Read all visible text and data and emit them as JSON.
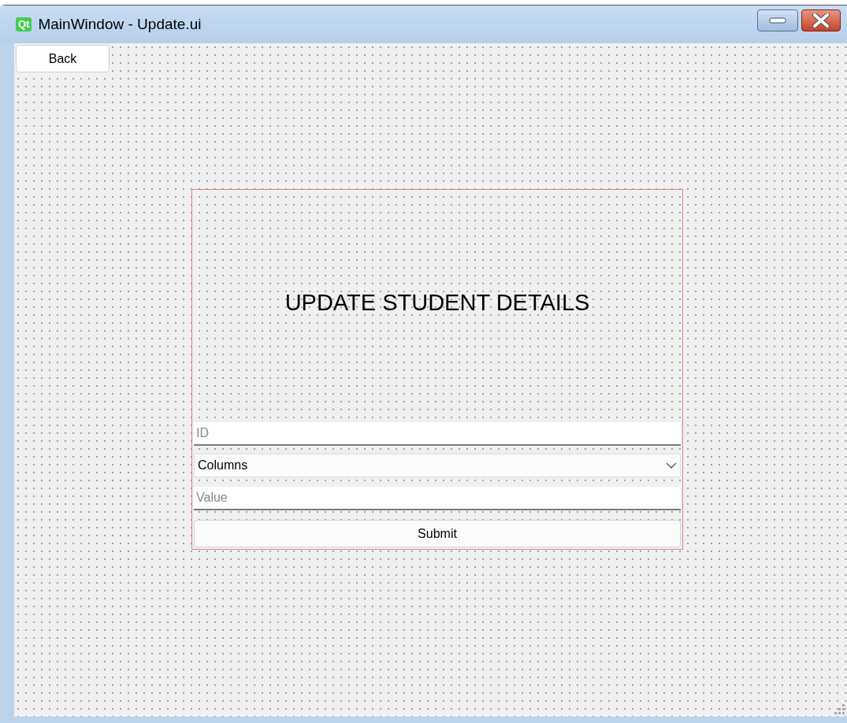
{
  "window": {
    "logo_text": "Qt",
    "title": "MainWindow - Update.ui"
  },
  "back_button": {
    "label": "Back"
  },
  "form": {
    "heading": "UPDATE STUDENT DETAILS",
    "id_field": {
      "placeholder": "ID"
    },
    "columns_dropdown": {
      "value": "Columns"
    },
    "value_field": {
      "placeholder": "Value"
    },
    "submit_button": {
      "label": "Submit"
    }
  }
}
